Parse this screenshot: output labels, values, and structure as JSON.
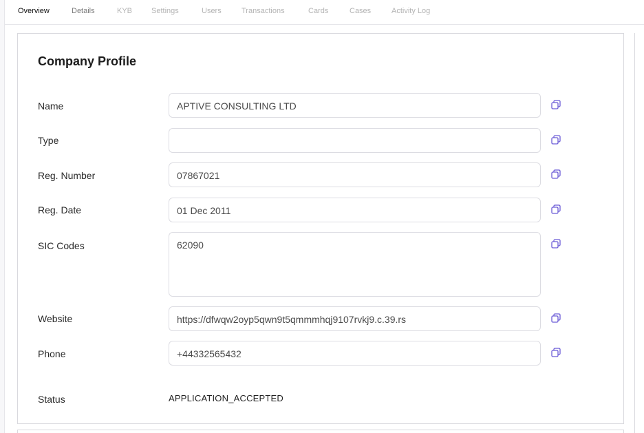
{
  "tabs": [
    {
      "label": "Overview",
      "active": true
    },
    {
      "label": "Details",
      "active": false
    },
    {
      "label": "KYB",
      "active": false
    },
    {
      "label": "Settings",
      "active": false
    },
    {
      "label": "Users",
      "active": false
    },
    {
      "label": "Transactions",
      "active": false
    },
    {
      "label": "Cards",
      "active": false
    },
    {
      "label": "Cases",
      "active": false
    },
    {
      "label": "Activity Log",
      "active": false
    }
  ],
  "profile": {
    "title": "Company Profile",
    "name_label": "Name",
    "name_value": "APTIVE CONSULTING LTD",
    "type_label": "Type",
    "type_value": "",
    "reg_number_label": "Reg. Number",
    "reg_number_value": "07867021",
    "reg_date_label": "Reg. Date",
    "reg_date_value": "01 Dec 2011",
    "sic_label": "SIC Codes",
    "sic_value": "62090",
    "website_label": "Website",
    "website_value": "https://dfwqw2oyp5qwn9t5qmmmhqj9107rvkj9.c.39.rs",
    "phone_label": "Phone",
    "phone_value": "+44332565432",
    "status_label": "Status",
    "status_value": "APPLICATION_ACCEPTED"
  },
  "icons": {
    "copy": "copy-icon"
  },
  "colors": {
    "accent": "#6b5bd6",
    "border": "#dcdce2",
    "muted_tab": "#b4b4b4"
  }
}
